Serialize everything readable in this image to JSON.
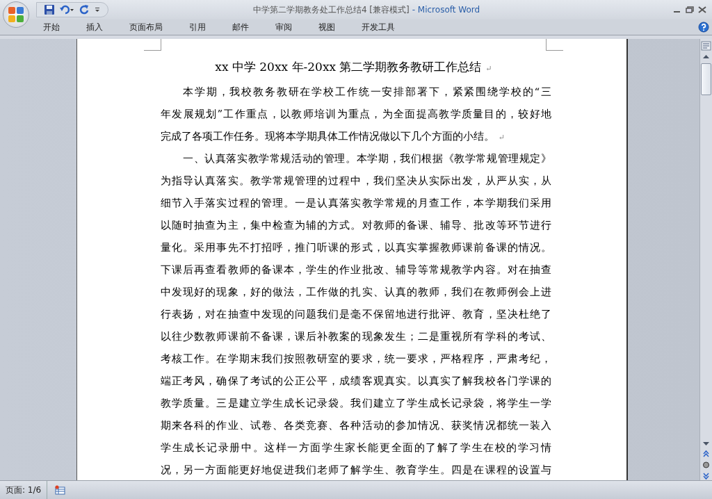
{
  "window": {
    "title": "中学第二学期教务处工作总结4 [兼容模式]",
    "app_name": "- Microsoft Word"
  },
  "ribbon_tabs": [
    {
      "label": "开始",
      "selected": false
    },
    {
      "label": "插入",
      "selected": false
    },
    {
      "label": "页面布局",
      "selected": false
    },
    {
      "label": "引用",
      "selected": false
    },
    {
      "label": "邮件",
      "selected": false
    },
    {
      "label": "审阅",
      "selected": false
    },
    {
      "label": "视图",
      "selected": false
    },
    {
      "label": "开发工具",
      "selected": false
    }
  ],
  "document": {
    "title": "xx 中学 20xx 年-20xx 第二学期教务教研工作总结",
    "title_mark": "↵",
    "paragraphs": [
      {
        "mark": "↵",
        "lines": [
          "本学期，我校教务教研在学校工作统一安排部署下，紧紧围绕学校的“三",
          "年发展规划”工作重点，以教师培训为重点，为全面提高教学质量目的，较好地",
          "完成了各项工作任务。现将本学期具体工作情况做以下几个方面的小结。"
        ]
      },
      {
        "lines": [
          "一、认真落实教学常规活动的管理。本学期，我们根据《教学常规管理规定》",
          "为指导认真落实。教学常规管理的过程中，我们坚决从实际出发，从严从实，从",
          "细节入手落实过程的管理。一是认真落实教学常规的月查工作，本学期我们采用",
          "以随时抽查为主，集中检查为辅的方式。对教师的备课、辅导、批改等环节进行",
          "量化。采用事先不打招呼，推门听课的形式，以真实掌握教师课前备课的情况。",
          "下课后再查看教师的备课本，学生的作业批改、辅导等常规教学内容。对在抽查",
          "中发现好的现象，好的做法，工作做的扎实、认真的教师，我们在教师例会上进",
          "行表扬，对在抽查中发现的问题我们是毫不保留地进行批评、教育，坚决杜绝了",
          "以往少数教师课前不备课，课后补教案的现象发生；二是重视所有学科的考试、",
          "考核工作。在学期末我们按照教研室的要求，统一要求，严格程序，严肃考纪，",
          "端正考风，确保了考试的公正公平，成绩客观真实。以真实了解我校各门学课的",
          "教学质量。三是建立学生成长记录袋。我们建立了学生成长记录袋，将学生一学",
          "期来各科的作业、试卷、各类竞赛、各种活动的参加情况、获奖情况都统一装入",
          "学生成长记录册中。这样一方面学生家长能更全面的了解了学生在校的学习情",
          "况，另一方面能更好地促进我们老师了解学生、教育学生。四是在课程的设置与"
        ]
      }
    ]
  },
  "status_bar": {
    "page": "页面: 1/6"
  }
}
